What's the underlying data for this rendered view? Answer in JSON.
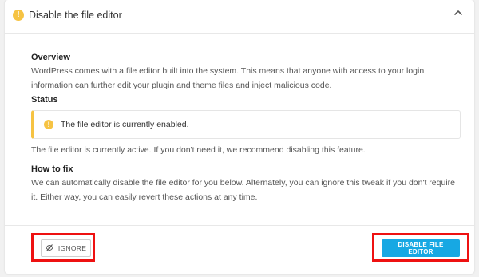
{
  "header": {
    "status_glyph": "!",
    "title": "Disable the file editor",
    "collapse_icon": "chevron-up-icon"
  },
  "overview": {
    "heading": "Overview",
    "body": "WordPress comes with a file editor built into the system. This means that anyone with access to your login information can further edit your plugin and theme files and inject malicious code."
  },
  "status": {
    "heading": "Status",
    "notice_glyph": "!",
    "notice_text": "The file editor is currently enabled.",
    "body": "The file editor is currently active. If you don't need it, we recommend disabling this feature."
  },
  "how_to_fix": {
    "heading": "How to fix",
    "body": "We can automatically disable the file editor for you below. Alternately, you can ignore this tweak if you don't require it. Either way, you can easily revert these actions at any time."
  },
  "actions": {
    "ignore_label": "IGNORE",
    "disable_label": "DISABLE FILE EDITOR"
  },
  "colors": {
    "warning": "#f6c343",
    "primary": "#17a8e3",
    "highlight": "#ee1111"
  }
}
